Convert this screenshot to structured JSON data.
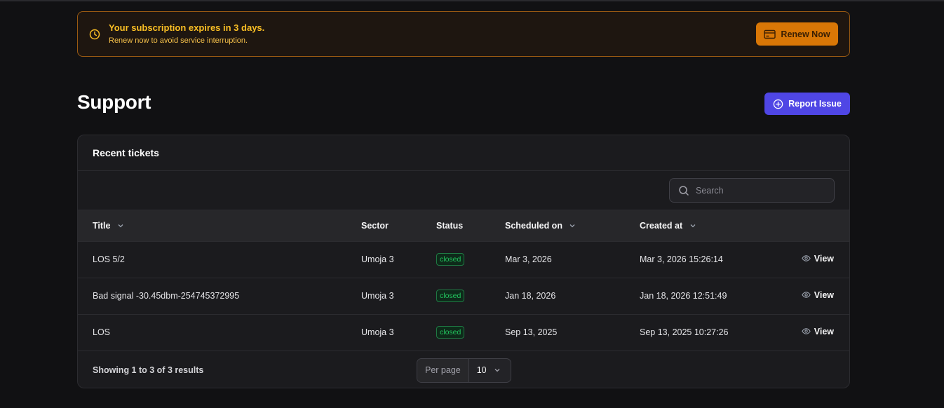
{
  "banner": {
    "title": "Your subscription expires in 3 days.",
    "subtitle": "Renew now to avoid service interruption.",
    "renew_label": "Renew Now",
    "icons": {
      "status": "clock-icon",
      "renew": "credit-card-icon"
    },
    "colors": {
      "accent": "#d97706",
      "text": "#fbbf24"
    }
  },
  "page": {
    "title": "Support",
    "report_label": "Report Issue",
    "report_icon": "plus-circle-icon",
    "accent": "#4f46e5"
  },
  "card": {
    "title": "Recent tickets",
    "search": {
      "placeholder": "Search",
      "value": ""
    }
  },
  "table": {
    "columns": [
      {
        "label": "Title",
        "sortable": true
      },
      {
        "label": "Sector",
        "sortable": false
      },
      {
        "label": "Status",
        "sortable": false
      },
      {
        "label": "Scheduled on",
        "sortable": true
      },
      {
        "label": "Created at",
        "sortable": true
      }
    ],
    "rows": [
      {
        "title": "LOS 5/2",
        "sector": "Umoja 3",
        "status": "closed",
        "scheduled": "Mar 3, 2026",
        "created": "Mar 3, 2026 15:26:14",
        "action": "View"
      },
      {
        "title": "Bad signal -30.45dbm-254745372995",
        "sector": "Umoja 3",
        "status": "closed",
        "scheduled": "Jan 18, 2026",
        "created": "Jan 18, 2026 12:51:49",
        "action": "View"
      },
      {
        "title": "LOS",
        "sector": "Umoja 3",
        "status": "closed",
        "scheduled": "Sep 13, 2025",
        "created": "Sep 13, 2025 10:27:26",
        "action": "View"
      }
    ],
    "status_color": "#22c55e"
  },
  "footer": {
    "results": "Showing 1 to 3 of 3 results",
    "per_page_label": "Per page",
    "per_page_value": "10"
  }
}
